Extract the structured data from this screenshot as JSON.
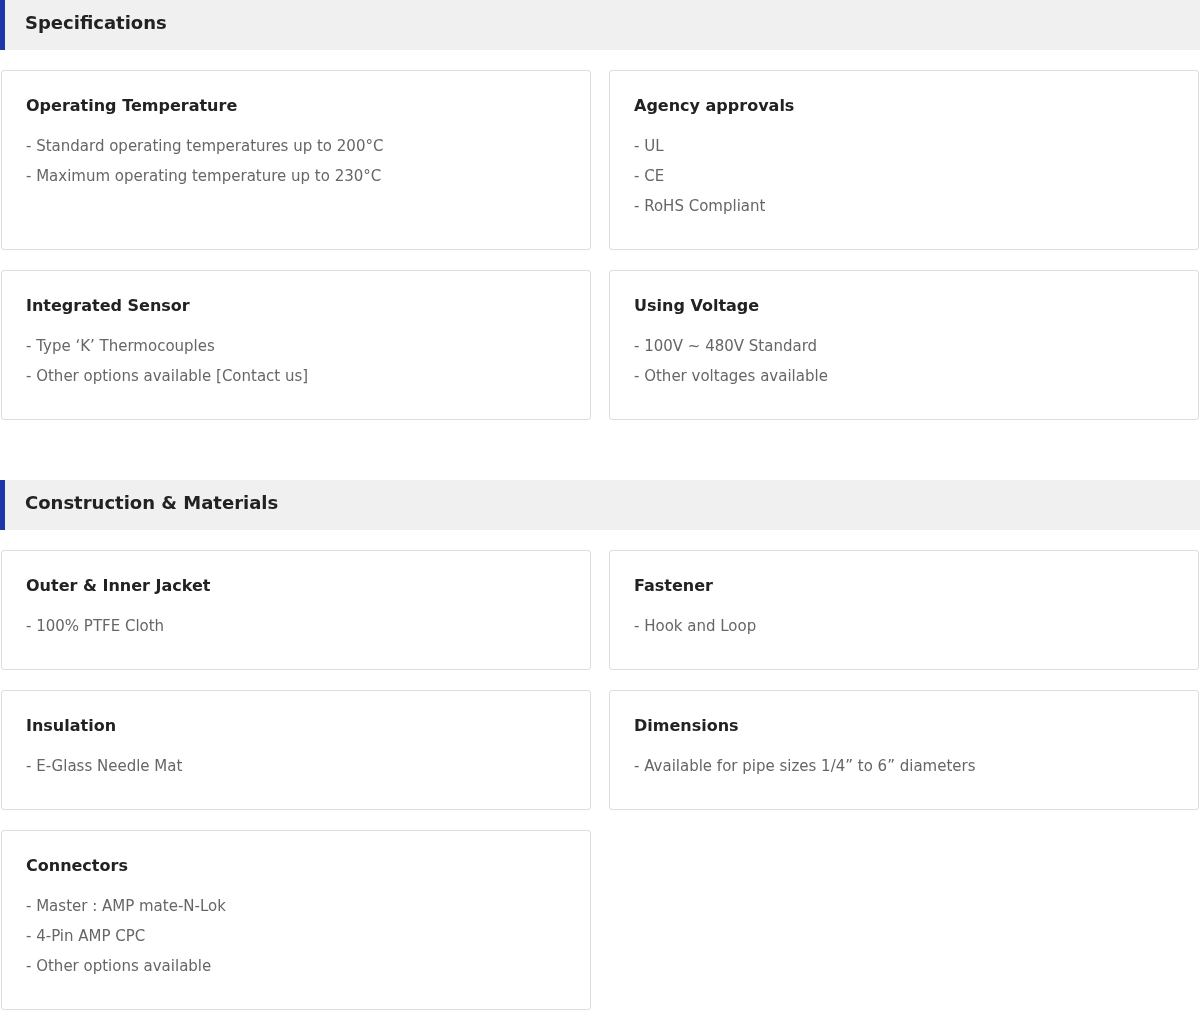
{
  "sections": [
    {
      "title": "Specifications",
      "cards": [
        {
          "title": "Operating Temperature",
          "lines": [
            "- Standard operating temperatures up to 200°C",
            "- Maximum operating temperature up to 230°C"
          ]
        },
        {
          "title": "Agency approvals",
          "lines": [
            "- UL",
            "- CE",
            "- RoHS Compliant"
          ]
        },
        {
          "title": "Integrated Sensor",
          "lines": [
            "- Type ‘K’ Thermocouples",
            "- Other options available [Contact us]"
          ]
        },
        {
          "title": "Using Voltage",
          "lines": [
            "- 100V ~ 480V Standard",
            "- Other voltages available"
          ]
        }
      ]
    },
    {
      "title": "Construction & Materials",
      "cards": [
        {
          "title": "Outer & Inner Jacket",
          "lines": [
            "- 100% PTFE Cloth"
          ]
        },
        {
          "title": "Fastener",
          "lines": [
            "- Hook and Loop"
          ]
        },
        {
          "title": "Insulation",
          "lines": [
            "- E-Glass Needle Mat"
          ]
        },
        {
          "title": "Dimensions",
          "lines": [
            "- Available for pipe sizes 1/4” to 6” diameters"
          ]
        },
        {
          "title": "Connectors",
          "lines": [
            "- Master : AMP mate-N-Lok",
            "- 4-Pin AMP CPC",
            "- Other options available"
          ]
        }
      ]
    }
  ]
}
